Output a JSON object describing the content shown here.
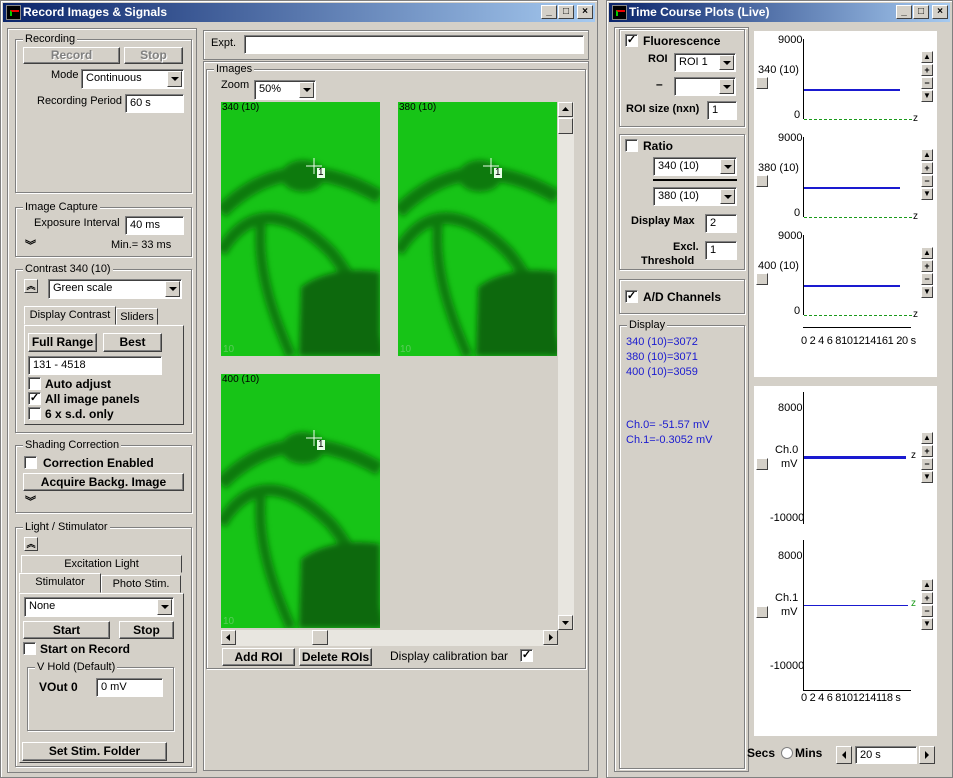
{
  "left_window": {
    "title": "Record Images & Signals",
    "recording": {
      "group": "Recording",
      "record_label": "Record",
      "stop_label": "Stop",
      "mode_label": "Mode",
      "mode_value": "Continuous",
      "period_label": "Recording Period",
      "period_value": "60 s"
    },
    "capture": {
      "group": "Image Capture",
      "exposure_label": "Exposure Interval",
      "exposure_value": "40 ms",
      "min_text": "Min.= 33 ms"
    },
    "contrast": {
      "group": "Contrast 340 (10)",
      "palette": "Green scale",
      "tab_display": "Display Contrast",
      "tab_sliders": "Sliders",
      "full_range": "Full Range",
      "best": "Best",
      "range_value": "131 - 4518",
      "auto_adjust": "Auto adjust",
      "all_panels": "All image panels",
      "six_sd": "6 x s.d. only"
    },
    "shading": {
      "group": "Shading Correction",
      "correction": "Correction Enabled",
      "acquire": "Acquire Backg. Image"
    },
    "light": {
      "group": "Light / Stimulator",
      "tab_excitation": "Excitation Light",
      "tab_stimulator": "Stimulator",
      "tab_photo": "Photo Stim.",
      "protocol": "None",
      "start": "Start",
      "stop": "Stop",
      "start_on_record": "Start on Record",
      "vhold_group": "V Hold (Default)",
      "vout_label": "VOut 0",
      "vout_value": "0 mV",
      "set_folder": "Set Stim. Folder"
    },
    "expt_label": "Expt.",
    "expt_value": "",
    "images": {
      "group": "Images",
      "zoom_label": "Zoom",
      "zoom_value": "50%",
      "panels": [
        {
          "caption": "340 (10)",
          "roi": "1",
          "bar": "10"
        },
        {
          "caption": "380 (10)",
          "roi": "1",
          "bar": "10"
        },
        {
          "caption": "400 (10)",
          "roi": "1",
          "bar": "10"
        }
      ],
      "add_roi": "Add ROI",
      "delete_rois": "Delete ROIs",
      "calibration_label": "Display calibration bar"
    }
  },
  "right_window": {
    "title": "Time Course Plots (Live)",
    "fluorescence_label": "Fluorescence",
    "roi_label": "ROI",
    "roi_value": "ROI 1",
    "minus": "–",
    "roi_size_label": "ROI size (nxn)",
    "roi_size_value": "1",
    "ratio_label": "Ratio",
    "ratio_num": "340 (10)",
    "ratio_den": "380 (10)",
    "display_max_label": "Display Max",
    "display_max_value": "2",
    "excl_label_1": "Excl.",
    "excl_label_2": "Threshold",
    "excl_value": "1",
    "ad_label": "A/D Channels",
    "display_group": "Display",
    "readouts": [
      "340 (10)=3072",
      "380 (10)=3071",
      "400 (10)=3059"
    ],
    "ch_readouts": [
      "Ch.0= -51.57 mV",
      "Ch.1=-0.3052 mV"
    ],
    "secs": "Secs",
    "mins": "Mins",
    "time_value": "20 s"
  },
  "plots": {
    "fluor": [
      {
        "label": "340 (10)",
        "ymax": "9000",
        "ymin": "0",
        "z": "z"
      },
      {
        "label": "380 (10)",
        "ymax": "9000",
        "ymin": "0",
        "z": "z"
      },
      {
        "label": "400 (10)",
        "ymax": "9000",
        "ymin": "0",
        "z": "z"
      }
    ],
    "fluor_xticks": "0 2 4 6 8101214161 20 s",
    "ad": [
      {
        "label1": "Ch.0",
        "label2": "mV",
        "ymax": "8000",
        "ymin": "-10000",
        "z": "z"
      },
      {
        "label1": "Ch.1",
        "label2": "mV",
        "ymax": "8000",
        "ymin": "-10000",
        "z": "z"
      }
    ],
    "ad_xticks": "0 2 4 6 8101214118 s"
  },
  "colors": {
    "title_start": "#0a246a",
    "title_end": "#a6caf0",
    "image_green": "#17c417",
    "trace_blue": "#1a1ad0",
    "zero_line_green": "#1a9a1a"
  }
}
